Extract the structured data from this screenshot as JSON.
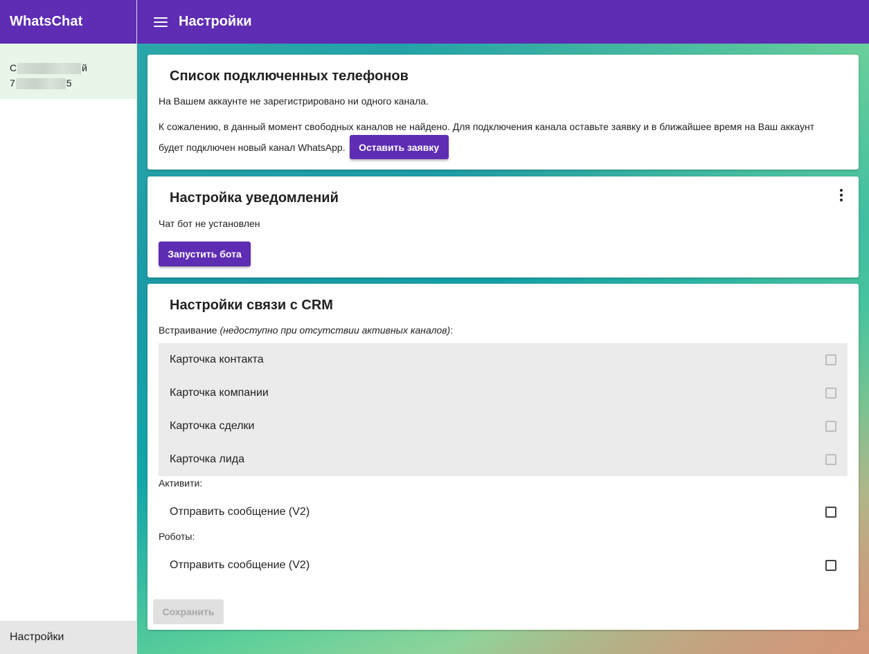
{
  "sidebar": {
    "brand": "WhatsChat",
    "account": {
      "name_start": "С",
      "name_end": "й",
      "phone_start": "7",
      "phone_end": "5"
    },
    "footer_label": "Настройки"
  },
  "topbar": {
    "title": "Настройки"
  },
  "cards": {
    "phones": {
      "title": "Список подключенных телефонов",
      "no_channels": "На Вашем аккаунте не зарегистрировано ни одного канала.",
      "sorry_line1": "К сожалению, в данный момент свободных каналов не найдено. Для подключения канала оставьте заявку и в ближайшее время на Ваш аккаунт",
      "sorry_line2": "будет подключен новый канал WhatsApp.",
      "request_button": "Оставить заявку"
    },
    "notifications": {
      "title": "Настройка уведомлений",
      "status": "Чат бот не установлен",
      "launch_button": "Запустить бота"
    },
    "crm": {
      "title": "Настройки связи с CRM",
      "embed_label": "Встраивание ",
      "embed_note": "(недоступно при отсутствии активных каналов)",
      "embed_colon": ":",
      "embed_items": [
        "Карточка контакта",
        "Карточка компании",
        "Карточка сделки",
        "Карточка лида"
      ],
      "activity_label": "Активити:",
      "activity_item": "Отправить сообщение (V2)",
      "robots_label": "Роботы:",
      "robots_item": "Отправить сообщение (V2)",
      "save_button": "Сохранить"
    }
  },
  "colors": {
    "accent": "#5e2db3",
    "selected_bg": "#e8f5e9",
    "disabled_bg": "#e0e0e0"
  }
}
